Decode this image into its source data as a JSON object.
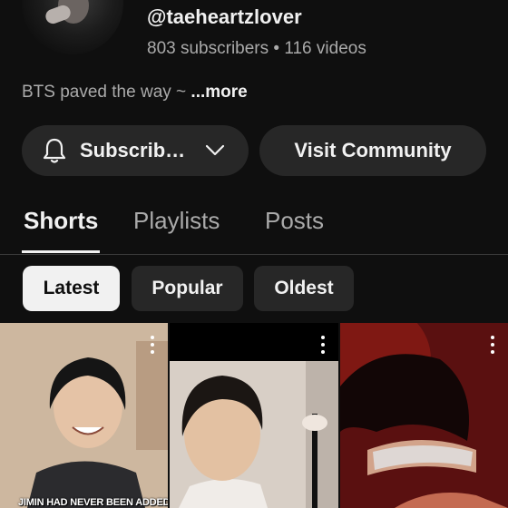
{
  "channel": {
    "handle": "@taeheartzlover",
    "stats": "803 subscribers • 116 videos",
    "description": "BTS paved the way ~ ",
    "more_label": "...more"
  },
  "actions": {
    "subscribe_label": "Subscrib…",
    "community_label": "Visit Community"
  },
  "tabs": [
    {
      "label": "Shorts",
      "active": true
    },
    {
      "label": "Playlists",
      "active": false
    },
    {
      "label": "Posts",
      "active": false
    }
  ],
  "filters": [
    {
      "label": "Latest",
      "selected": true
    },
    {
      "label": "Popular",
      "selected": false
    },
    {
      "label": "Oldest",
      "selected": false
    }
  ],
  "shorts": [
    {
      "caption": "JIMIN HAD NEVER BEEN ADDED TO",
      "icon": "more-vert-icon"
    },
    {
      "caption": "",
      "icon": "more-vert-icon"
    },
    {
      "caption": "",
      "icon": "more-vert-icon"
    }
  ],
  "colors": {
    "background": "#0f0f0f",
    "surface": "#272727",
    "text_primary": "#f1f1f1",
    "text_secondary": "#aaaaaa"
  }
}
